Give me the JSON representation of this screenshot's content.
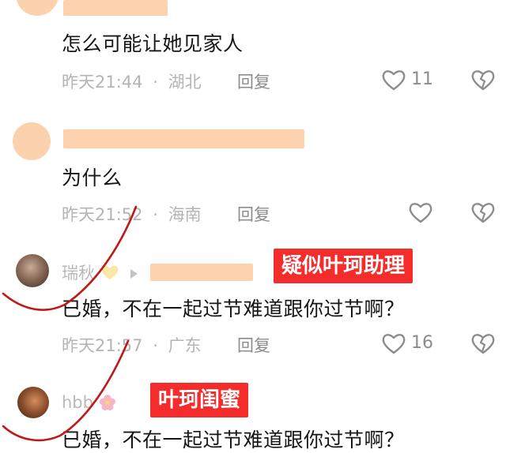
{
  "comments": [
    {
      "text": "怎么可能让她见家人",
      "time": "昨天21:44",
      "location": "湖北",
      "reply_label": "回复",
      "like_count": "11"
    },
    {
      "text": "为什么",
      "time": "昨天21:52",
      "location": "海南",
      "reply_label": "回复",
      "like_count": ""
    },
    {
      "username": "瑞秋",
      "text": "已婚，不在一起过节难道跟你过节啊？",
      "time": "昨天21:57",
      "location": "广东",
      "reply_label": "回复",
      "like_count": "16",
      "tag": "疑似叶珂助理"
    },
    {
      "username": "hbb",
      "text": "已婚，不在一起过节难道跟你过节啊？",
      "tag": "叶珂闺蜜"
    }
  ],
  "separator": "·",
  "colors": {
    "tag_bg": "#f52c2c",
    "redaction": "#fcd3ae",
    "annotation_stroke": "#c01818"
  },
  "icons": [
    "heart-outline-icon",
    "broken-heart-icon",
    "reply-arrow-icon",
    "heart-emoji-icon",
    "flower-emoji-icon"
  ]
}
